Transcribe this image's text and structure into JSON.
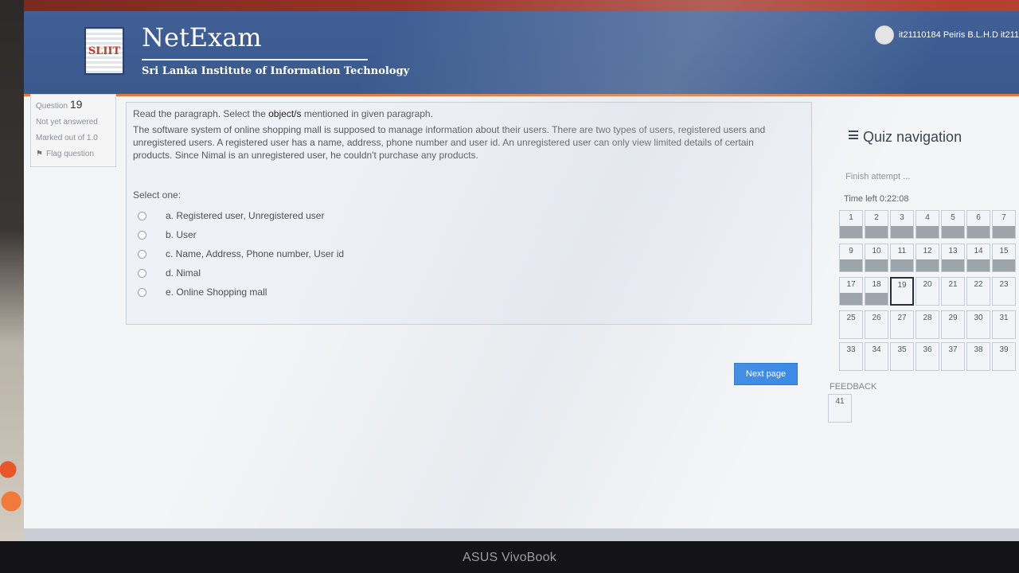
{
  "laptop": {
    "brand": "ASUS VivoBook"
  },
  "header": {
    "logo_text": "SLIIT",
    "brand_name": "NetExam",
    "brand_subtitle": "Sri Lanka Institute of Information Technology",
    "user_name": "it21110184 Peiris B.L.H.D it211"
  },
  "question_info": {
    "question_label": "Question",
    "question_number": "19",
    "status": "Not yet answered",
    "marked_out_of": "Marked out of 1.0",
    "flag_label": "Flag question"
  },
  "question": {
    "prompt_pre": "Read the paragraph. Select the ",
    "prompt_bold": "object/s",
    "prompt_post": " mentioned in given paragraph.",
    "paragraph": "The software system of online shopping mall is supposed to manage information about their users. There are two types of users, registered users and unregistered users. A registered user has a name, address, phone number and user id. An unregistered user can only view limited details of certain products. Since Nimal is an unregistered user, he couldn't purchase any products.",
    "select_one": "Select one:",
    "options": [
      "a. Registered user, Unregistered user",
      "b. User",
      "c. Name, Address, Phone number, User id",
      "d. Nimal",
      "e. Online Shopping mall"
    ],
    "next_page_label": "Next page"
  },
  "quiz_nav": {
    "title": "Quiz navigation",
    "finish_attempt": "Finish attempt ...",
    "time_left": "Time left 0:22:08",
    "current_question": "19",
    "rows": [
      [
        "1",
        "2",
        "3",
        "4",
        "5",
        "6",
        "7"
      ],
      [
        "9",
        "10",
        "11",
        "12",
        "13",
        "14",
        "15"
      ],
      [
        "17",
        "18",
        "19",
        "20",
        "21",
        "22",
        "23"
      ],
      [
        "25",
        "26",
        "27",
        "28",
        "29",
        "30",
        "31"
      ],
      [
        "33",
        "34",
        "35",
        "36",
        "37",
        "38",
        "39"
      ]
    ],
    "answered": [
      "1",
      "2",
      "3",
      "4",
      "5",
      "6",
      "7",
      "9",
      "10",
      "11",
      "12",
      "13",
      "14",
      "15",
      "17",
      "18"
    ],
    "feedback_label": "FEEDBACK",
    "feedback_question": "41"
  }
}
